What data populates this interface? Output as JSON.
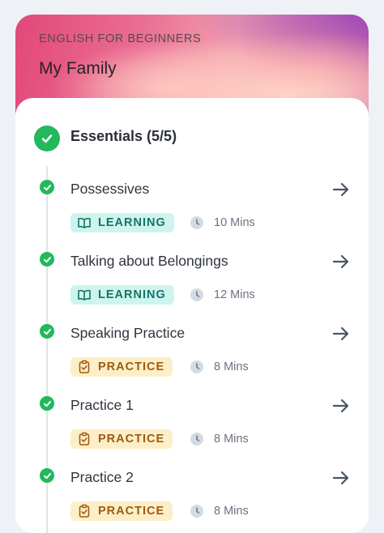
{
  "course": {
    "kicker": "ENGLISH FOR BEGINNERS",
    "title": "My Family"
  },
  "section": {
    "title": "Essentials (5/5)"
  },
  "items": [
    {
      "title": "Possessives",
      "type": "LEARNING",
      "duration": "10 Mins"
    },
    {
      "title": "Talking about Belongings",
      "type": "LEARNING",
      "duration": "12 Mins"
    },
    {
      "title": "Speaking Practice",
      "type": "PRACTICE",
      "duration": "8 Mins"
    },
    {
      "title": "Practice 1",
      "type": "PRACTICE",
      "duration": "8 Mins"
    },
    {
      "title": "Practice 2",
      "type": "PRACTICE",
      "duration": "8 Mins"
    }
  ],
  "colors": {
    "success": "#22b85c",
    "learning_bg": "#cdf5ee",
    "learning_text": "#177368",
    "practice_bg": "#fcefc7",
    "practice_text": "#a05a12"
  },
  "icons": {
    "section_status": "check-circle-icon",
    "item_status": "check-icon",
    "learning": "book-open-icon",
    "practice": "clipboard-check-icon",
    "duration": "clock-icon",
    "open": "arrow-right-icon"
  }
}
